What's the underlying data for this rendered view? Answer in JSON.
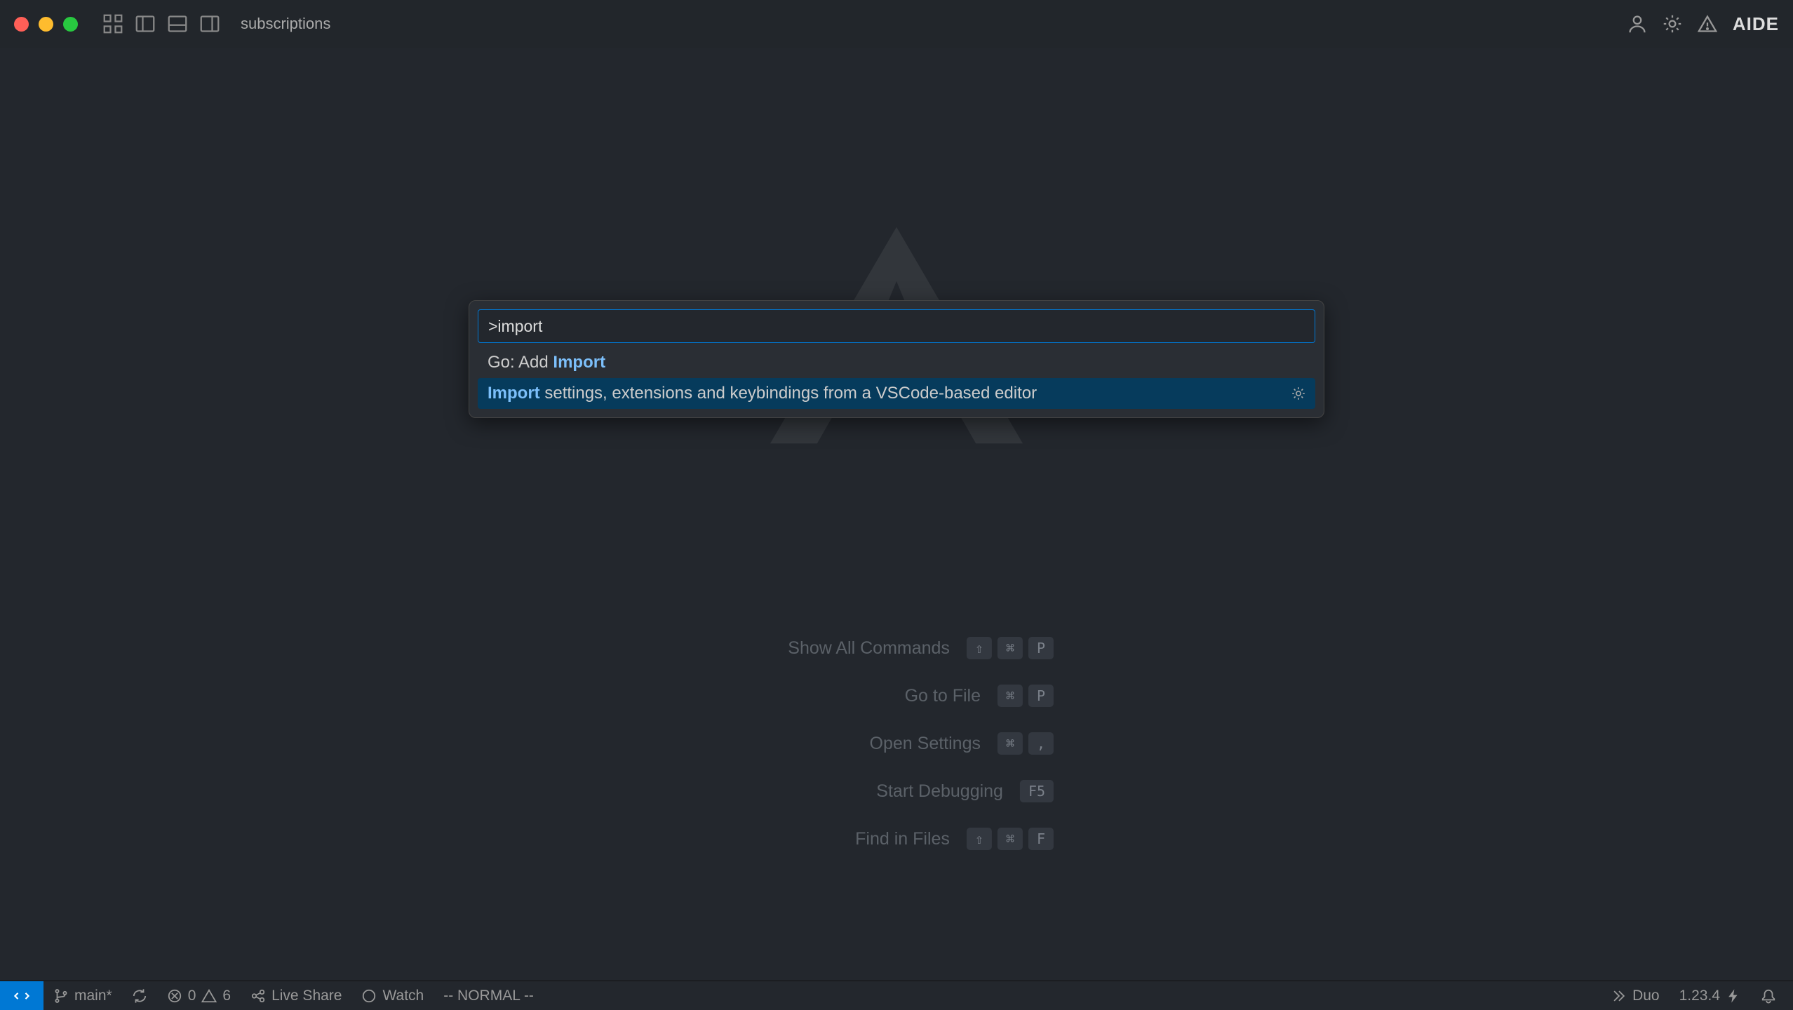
{
  "titlebar": {
    "title": "subscriptions",
    "brand": "AIDE"
  },
  "palette": {
    "input_value": ">import",
    "items": [
      {
        "prefix": "Go: Add ",
        "highlight": "Import",
        "suffix": "",
        "selected": false
      },
      {
        "prefix": "",
        "highlight": "Import",
        "suffix": " settings, extensions and keybindings from a VSCode-based editor",
        "selected": true
      }
    ]
  },
  "shortcuts": [
    {
      "label": "Show All Commands",
      "keys": [
        "⇧",
        "⌘",
        "P"
      ]
    },
    {
      "label": "Go to File",
      "keys": [
        "⌘",
        "P"
      ]
    },
    {
      "label": "Open Settings",
      "keys": [
        "⌘",
        ","
      ]
    },
    {
      "label": "Start Debugging",
      "keys": [
        "F5"
      ]
    },
    {
      "label": "Find in Files",
      "keys": [
        "⇧",
        "⌘",
        "F"
      ]
    }
  ],
  "statusbar": {
    "branch": "main*",
    "errors": "0",
    "warnings": "6",
    "live_share": "Live Share",
    "watch": "Watch",
    "vim_mode": "-- NORMAL --",
    "duo": "Duo",
    "version": "1.23.4"
  }
}
